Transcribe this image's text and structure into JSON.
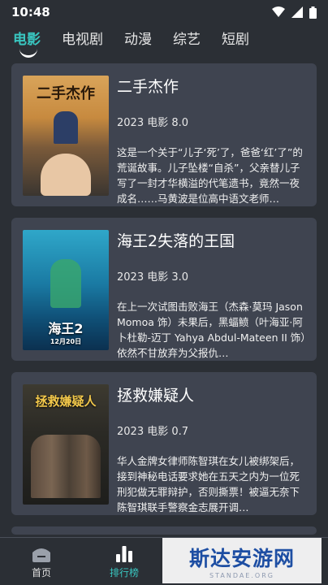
{
  "status": {
    "time": "10:48"
  },
  "tabs": [
    {
      "label": "电影"
    },
    {
      "label": "电视剧"
    },
    {
      "label": "动漫"
    },
    {
      "label": "综艺"
    },
    {
      "label": "短剧"
    }
  ],
  "movies": [
    {
      "title": "二手杰作",
      "meta": "2023 电影 8.0",
      "desc": "这是一个关于“儿子‘死’了，爸爸‘红’了”的荒诞故事。儿子坠楼“自杀”，父亲替儿子写了一封才华横溢的代笔遗书，竟然一夜成名……马黄波是位高中语文老师…",
      "poster_title": "二手杰作"
    },
    {
      "title": "海王2失落的王国",
      "meta": "2023 电影 3.0",
      "desc": "在上一次试图击败海王（杰森·莫玛 Jason Momoa 饰）未果后，黑蝠鲼（叶海亚·阿卜杜勒-迈丁 Yahya Abdul-Mateen II 饰）依然不甘放弃为父报仇…",
      "poster_title": "海王2",
      "poster_date": "12月20日"
    },
    {
      "title": "拯救嫌疑人",
      "meta": "2023 电影 0.7",
      "desc": "华人金牌女律师陈智琪在女儿被绑架后，接到神秘电话要求她在五天之内为一位死刑犯做无罪辩护，否则撕票！被逼无奈下陈智琪联手警察金志展开调…",
      "poster_title": "拯救嫌疑人"
    }
  ],
  "bottom_nav": [
    {
      "label": "首页",
      "icon": "home-icon"
    },
    {
      "label": "排行榜",
      "icon": "rank-icon"
    }
  ],
  "watermark": {
    "main": "斯达安游网",
    "sub": "STANDAE.ORG"
  },
  "colors": {
    "accent": "#39c6c0",
    "card": "#3f4450",
    "background": "#2b2f35"
  }
}
